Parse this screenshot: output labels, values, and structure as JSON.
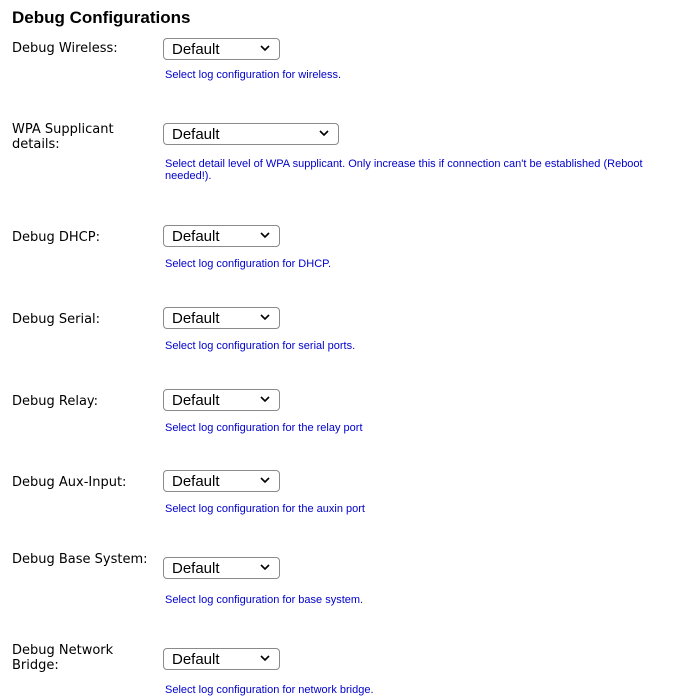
{
  "title": "Debug Configurations",
  "rows": [
    {
      "label": "Debug Wireless:",
      "value": "Default",
      "help": "Select log configuration for wireless."
    },
    {
      "label": "WPA Supplicant details:",
      "value": "Default",
      "help": "Select detail level of WPA supplicant. Only increase this if connection can't be established (Reboot needed!)."
    },
    {
      "label": "Debug DHCP:",
      "value": "Default",
      "help": "Select log configuration for DHCP."
    },
    {
      "label": "Debug Serial:",
      "value": "Default",
      "help": "Select log configuration for serial ports."
    },
    {
      "label": "Debug Relay:",
      "value": "Default",
      "help": "Select log configuration for the relay port"
    },
    {
      "label": "Debug Aux-Input:",
      "value": "Default",
      "help": "Select log configuration for the auxin port"
    },
    {
      "label": "Debug Base System:",
      "value": "Default",
      "help": "Select log configuration for base system."
    },
    {
      "label": "Debug Network Bridge:",
      "value": "Default",
      "help": "Select log configuration for network bridge."
    }
  ],
  "icons": {
    "dropdown": "chevron-down-icon"
  }
}
